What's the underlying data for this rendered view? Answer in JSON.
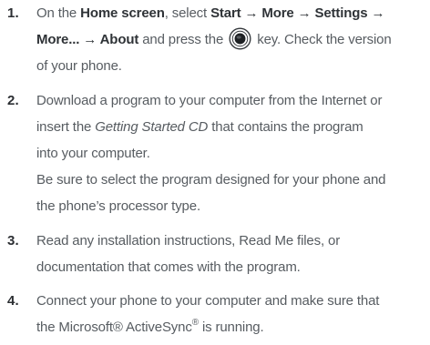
{
  "steps": [
    {
      "number": "1.",
      "line1": {
        "pre": "On the ",
        "bold1": "Home screen",
        "mid": ", select ",
        "bold2": "Start → More → Settings →"
      },
      "line2": {
        "bold": "More... → About",
        "mid": " and press the",
        "post": "key. Check the version"
      },
      "line3": "of your phone.",
      "key_icon": "ok-key-icon"
    },
    {
      "number": "2.",
      "line1": "Download a program to your computer from the Internet or",
      "line2": {
        "pre": "insert the ",
        "italic": "Getting Started CD",
        "post": " that contains the program"
      },
      "line3": "into your computer.",
      "line4": "Be sure to select the program designed for your phone and",
      "line5": "the phone’s processor type."
    },
    {
      "number": "3.",
      "line1": "Read any installation instructions, Read Me files, or",
      "line2": "documentation that comes with the program."
    },
    {
      "number": "4.",
      "line1": "Connect your phone to your computer and make sure that",
      "line2": {
        "pre": "the Microsoft® ActiveSync",
        "sup": "®",
        "post": " is running."
      }
    }
  ]
}
